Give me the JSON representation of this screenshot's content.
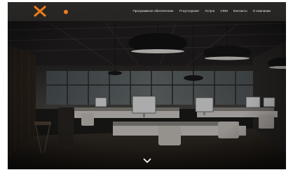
{
  "brand": {
    "name": "X",
    "accent": "#f07d1a"
  },
  "nav": {
    "items": [
      {
        "label": "Программное обеспечение"
      },
      {
        "label": "IT-аутсорсинг"
      },
      {
        "label": "Услуги"
      },
      {
        "label": "CRM"
      },
      {
        "label": "Контакты"
      },
      {
        "label": "О компании"
      }
    ]
  },
  "hero": {
    "scroll_icon": "chevron-down-icon",
    "image": "office-interior"
  }
}
